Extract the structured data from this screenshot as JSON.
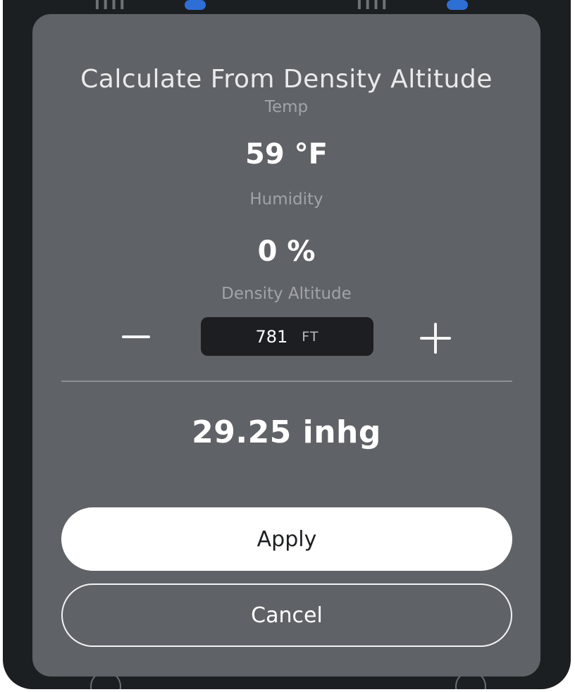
{
  "dialog": {
    "title": "Calculate From Density Altitude",
    "temp_label": "Temp",
    "temp_value": "59 °F",
    "humidity_label": "Humidity",
    "humidity_value": "0 %",
    "density_altitude_label": "Density Altitude",
    "density_altitude_value": "781",
    "density_altitude_unit": "FT",
    "result": "29.25 inhg",
    "apply_label": "Apply",
    "cancel_label": "Cancel"
  },
  "icons": {
    "decrement": "minus-icon",
    "increment": "plus-icon"
  },
  "colors": {
    "modal_bg": "#5f6266",
    "field_bg": "#1c1e21",
    "accent_blue": "#2e6fd6"
  }
}
